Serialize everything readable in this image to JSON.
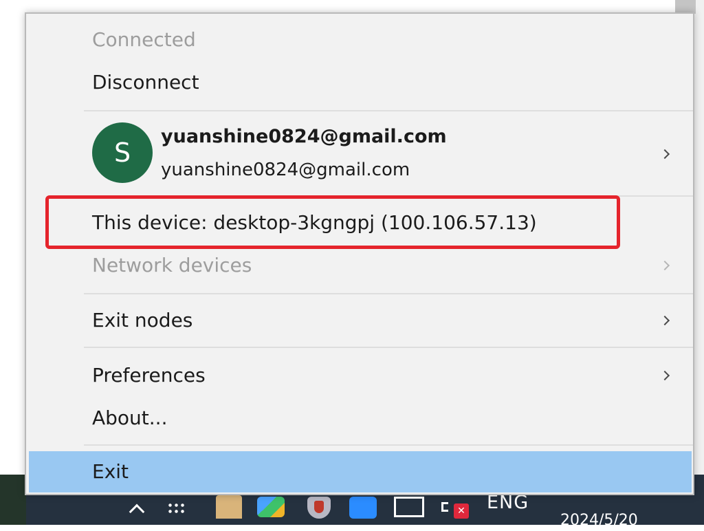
{
  "menu": {
    "status_label": "Connected",
    "disconnect_label": "Disconnect",
    "account": {
      "avatar_letter": "S",
      "name": "yuanshine0824@gmail.com",
      "email": "yuanshine0824@gmail.com",
      "avatar_color": "#1f6b46"
    },
    "this_device_label": "This device: desktop-3kgngpj (100.106.57.13)",
    "network_devices_label": "Network devices",
    "exit_nodes_label": "Exit nodes",
    "preferences_label": "Preferences",
    "about_label": "About...",
    "exit_label": "Exit",
    "highlight_color": "#e5242c",
    "hover_color": "#99c8f2"
  },
  "taskbar": {
    "language": "ENG",
    "clock_partial": "2024/5/20",
    "icons": [
      "chevron-up-icon",
      "grid-icon",
      "folder-icon",
      "app-icon",
      "shield-icon",
      "pin-icon",
      "network-icon",
      "volume-muted-icon"
    ]
  }
}
